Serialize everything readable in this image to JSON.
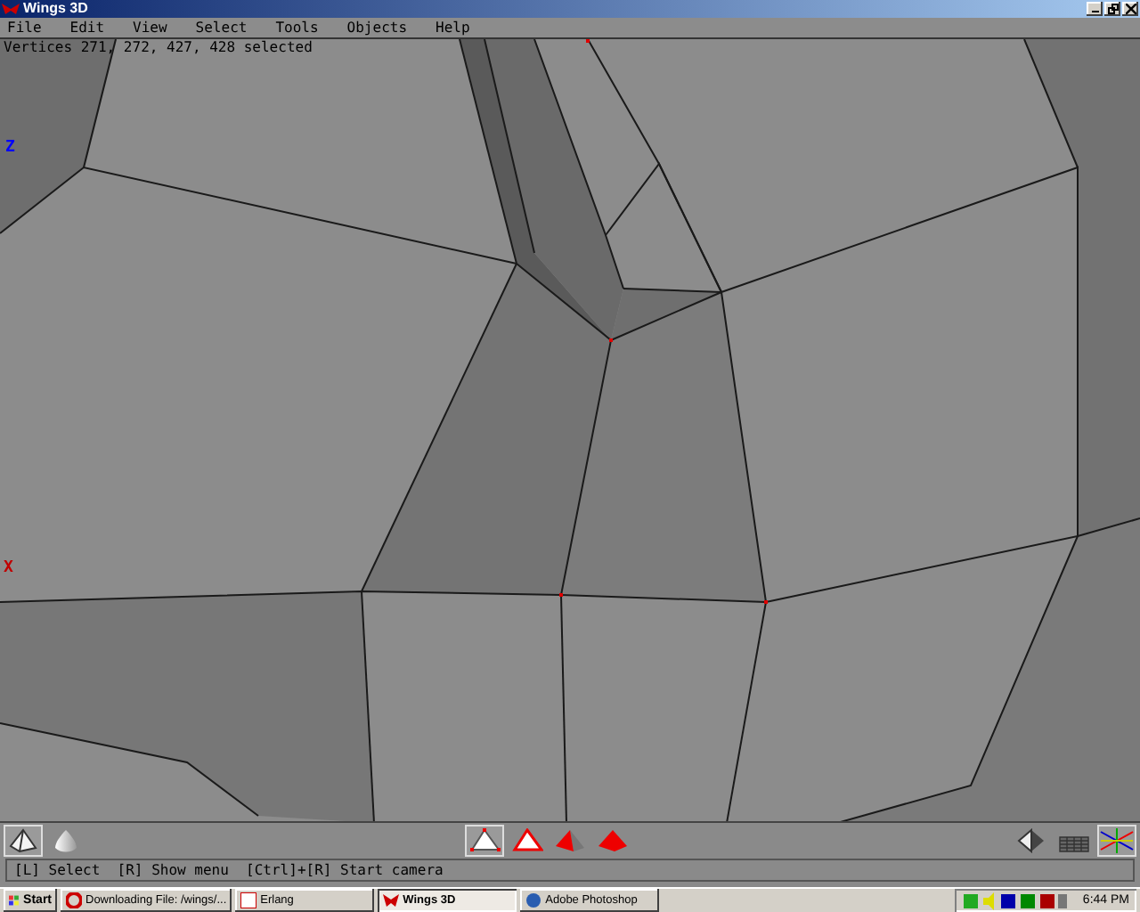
{
  "window": {
    "title": "Wings 3D"
  },
  "menu": [
    {
      "label": "File"
    },
    {
      "label": "Edit"
    },
    {
      "label": "View"
    },
    {
      "label": "Select"
    },
    {
      "label": "Tools"
    },
    {
      "label": "Objects"
    },
    {
      "label": "Help"
    }
  ],
  "viewport": {
    "selection_info": "Vertices 271, 272, 427, 428 selected",
    "axis_labels": [
      {
        "label": "Z",
        "color": "#0000ff"
      },
      {
        "label": "X",
        "color": "#c00000"
      }
    ]
  },
  "toolbar": {
    "shading_modes": [
      {
        "kind": "wireframe",
        "selected": true
      },
      {
        "kind": "smooth",
        "selected": false
      }
    ],
    "select_modes": [
      {
        "kind": "vertex",
        "selected": true
      },
      {
        "kind": "edge",
        "selected": false
      },
      {
        "kind": "face",
        "selected": false
      },
      {
        "kind": "body",
        "selected": false
      }
    ],
    "view_modes": [
      {
        "kind": "perspective",
        "selected": false
      },
      {
        "kind": "ground",
        "selected": false
      },
      {
        "kind": "axes",
        "selected": true
      }
    ]
  },
  "status_bar": {
    "text": "[L] Select  [R] Show menu  [Ctrl]+[R] Start camera"
  },
  "taskbar": {
    "start": "Start",
    "tasks": [
      {
        "label": "Downloading File: /wings/...",
        "kind": "download",
        "selected": false
      },
      {
        "label": "Erlang",
        "kind": "erlang",
        "selected": false
      },
      {
        "label": "Wings 3D",
        "kind": "wings",
        "selected": true
      },
      {
        "label": "Adobe Photoshop",
        "kind": "photoshop",
        "selected": false
      }
    ],
    "clock": "6:44 PM"
  }
}
